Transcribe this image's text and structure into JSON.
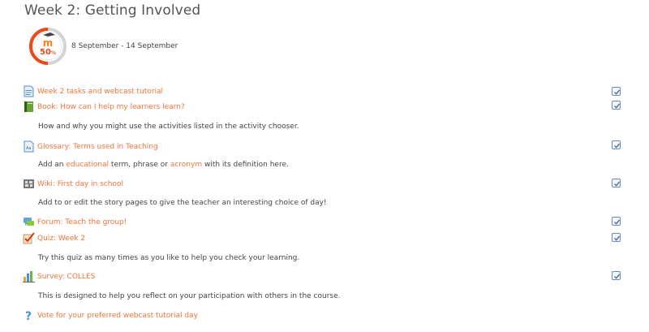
{
  "week": {
    "title": "Week 2: Getting Involved",
    "progress": "50",
    "progress_unit": "%",
    "date_range": "8 September - 14 September"
  },
  "activities": [
    {
      "label": "Week 2 tasks and webcast tutorial",
      "icon": "page-icon",
      "completed": true
    },
    {
      "label": "Book: How can I help my learners learn?",
      "icon": "book-icon",
      "completed": true,
      "description": "How and why you might use the activities listed in the activity chooser."
    },
    {
      "label": "Glossary: Terms used in Teaching",
      "icon": "glossary-icon",
      "completed": true,
      "description_parts": [
        "Add an ",
        "educational",
        " term, phrase or ",
        "acronym",
        " with its definition here."
      ]
    },
    {
      "label": "Wiki: First day in school",
      "icon": "wiki-icon",
      "completed": true,
      "description": "Add to or edit the story pages to give the teacher an interesting choice of day!"
    },
    {
      "label": "Forum: Teach the group!",
      "icon": "forum-icon",
      "completed": true
    },
    {
      "label": "Quiz: Week 2",
      "icon": "quiz-icon",
      "completed": true,
      "description": "Try this quiz as many times as you like to help you check your learning."
    },
    {
      "label": "Survey: COLLES",
      "icon": "survey-icon",
      "completed": true,
      "description": "This is designed to help you reflect on your participation with others in the course."
    },
    {
      "label": "Vote for your preferred webcast tutorial day",
      "icon": "question-icon",
      "completed": false
    }
  ],
  "colors": {
    "link": "#f4743b",
    "progress_ring": "#e74c1a",
    "check": "#4a6fa5"
  }
}
